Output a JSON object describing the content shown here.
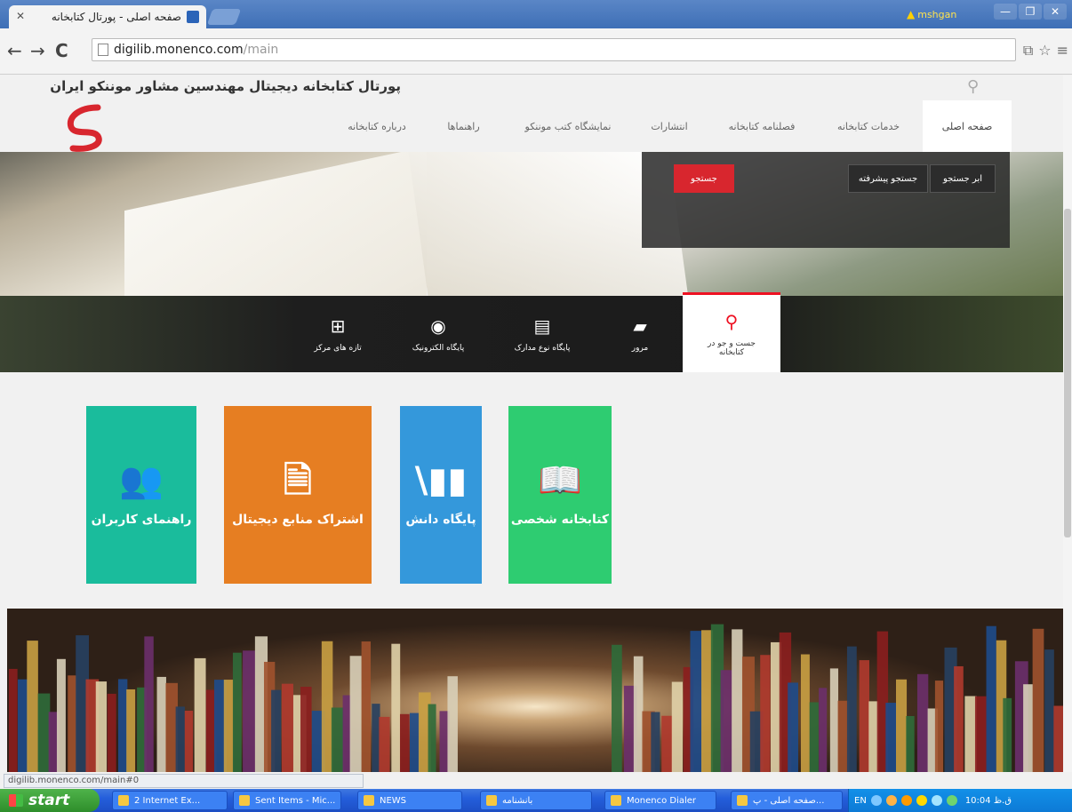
{
  "browser": {
    "tab_title": "صفحه اصلی - پورتال کتابخانه",
    "user_name": "mshgan",
    "url_host": "digilib.monenco.com",
    "url_path": "/main",
    "status_url": "digilib.monenco.com/main#0"
  },
  "site": {
    "title": "پورتال کتابخانه دیجیتال مهندسین مشاور موننکو ایران",
    "nav": [
      {
        "label": "صفحه اصلی"
      },
      {
        "label": "خدمات کتابخانه"
      },
      {
        "label": "فصلنامه کتابخانه"
      },
      {
        "label": "انتشارات"
      },
      {
        "label": "نمایشگاه کتب موننکو"
      },
      {
        "label": "راهنماها"
      },
      {
        "label": "درباره کتابخانه"
      }
    ],
    "search_panel": {
      "tab_search": "جستجو",
      "tab_advanced": "جستجو پیشرفته",
      "tab_meta": "ابر جستجو"
    },
    "quick": [
      {
        "label": "جست و جو در کتابخانه",
        "icon": "search-icon"
      },
      {
        "label": "مرور",
        "icon": "folder-icon"
      },
      {
        "label": "پایگاه نوع مدارک",
        "icon": "document-icon"
      },
      {
        "label": "پایگاه الکترونیک",
        "icon": "disc-icon"
      },
      {
        "label": "تازه های مرکز",
        "icon": "add-file-icon"
      }
    ],
    "tiles": [
      {
        "label": "کتابخانه شخصی",
        "icon": "reader-book-icon",
        "color": "#2ecc71"
      },
      {
        "label": "پایگاه دانش",
        "icon": "bookshelf-icon",
        "color": "#3498db"
      },
      {
        "label": "اشتراک منابع دیجیتال",
        "icon": "document-download-icon",
        "color": "#e67e22"
      },
      {
        "label": "راهنمای کاربران",
        "icon": "users-question-icon",
        "color": "#1abc9c"
      }
    ]
  },
  "taskbar": {
    "start": "start",
    "buttons": [
      {
        "label": "2 Internet Ex..."
      },
      {
        "label": "Sent Items - Mic..."
      },
      {
        "label": "NEWS"
      },
      {
        "label": "بانشنامه"
      },
      {
        "label": "Monenco Dialer"
      },
      {
        "label": "صفحه اصلی - پ..."
      }
    ],
    "lang": "EN",
    "clock": "10:04 ق.ظ"
  }
}
